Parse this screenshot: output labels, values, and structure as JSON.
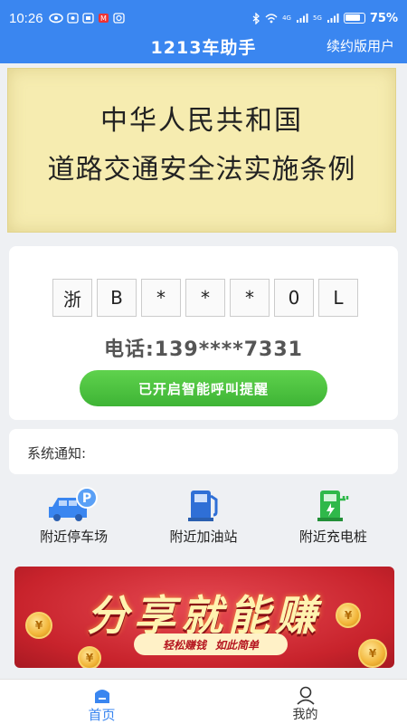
{
  "status": {
    "time": "10:26",
    "battery": "75%",
    "network": "4G",
    "network2": "5G"
  },
  "header": {
    "title": "1213车助手",
    "user_type": "续约版用户"
  },
  "banner": {
    "line1": "中华人民共和国",
    "line2": "道路交通安全法实施条例"
  },
  "plate": {
    "chars": [
      "浙",
      "B",
      "*",
      "*",
      "*",
      "0",
      "L"
    ]
  },
  "phone": "电话:139****7331",
  "call_button": "已开启智能呼叫提醒",
  "notice_label": "系统通知:",
  "services": [
    {
      "label": "附近停车场",
      "icon": "parking-car-icon"
    },
    {
      "label": "附近加油站",
      "icon": "gas-pump-icon"
    },
    {
      "label": "附近充电桩",
      "icon": "ev-charger-icon"
    }
  ],
  "promo": {
    "headline": "分享就能赚",
    "tag1": "轻松赚钱",
    "tag2": "如此简单"
  },
  "tabs": [
    {
      "label": "首页",
      "icon": "home-icon",
      "active": true
    },
    {
      "label": "我的",
      "icon": "user-icon",
      "active": false
    }
  ],
  "colors": {
    "primary": "#3a86f0",
    "button_green": "#4cc23e",
    "promo_red": "#c8232c"
  }
}
